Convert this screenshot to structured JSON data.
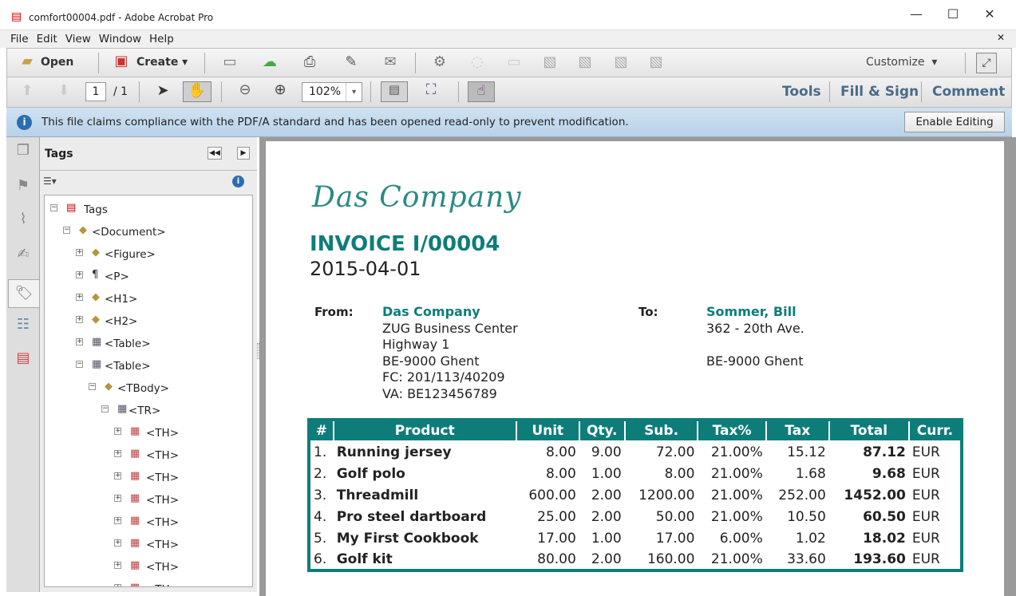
{
  "window": {
    "title": "comfort00004.pdf - Adobe Acrobat Pro",
    "minimize": "—",
    "maximize": "☐",
    "close": "✕",
    "doc_close": "✕"
  },
  "menu": [
    "File",
    "Edit",
    "View",
    "Window",
    "Help"
  ],
  "toolbar": {
    "open": "Open",
    "create": "Create",
    "customize": "Customize"
  },
  "nav": {
    "page": "1",
    "page_total": "/ 1",
    "zoom": "102%",
    "tools": "Tools",
    "fill_sign": "Fill & Sign",
    "comment": "Comment"
  },
  "infobar": {
    "message": "This file claims compliance with the PDF/A standard and has been opened read-only to prevent modification.",
    "enable": "Enable Editing"
  },
  "tags_panel": {
    "title": "Tags",
    "tree": [
      {
        "label": "Tags",
        "level": 0,
        "exp": "−",
        "icon": "pdf"
      },
      {
        "label": "<Document>",
        "level": 1,
        "exp": "−",
        "icon": "tag"
      },
      {
        "label": "<Figure>",
        "level": 2,
        "exp": "+",
        "icon": "tag"
      },
      {
        "label": "<P>",
        "level": 2,
        "exp": "+",
        "icon": "para"
      },
      {
        "label": "<H1>",
        "level": 2,
        "exp": "+",
        "icon": "tag"
      },
      {
        "label": "<H2>",
        "level": 2,
        "exp": "+",
        "icon": "tag"
      },
      {
        "label": "<Table>",
        "level": 2,
        "exp": "+",
        "icon": "table"
      },
      {
        "label": "<Table>",
        "level": 2,
        "exp": "−",
        "icon": "table"
      },
      {
        "label": "<TBody>",
        "level": 3,
        "exp": "−",
        "icon": "tag"
      },
      {
        "label": "<TR>",
        "level": 4,
        "exp": "−",
        "icon": "table"
      },
      {
        "label": "<TH>",
        "level": 5,
        "exp": "+",
        "icon": "cell"
      },
      {
        "label": "<TH>",
        "level": 5,
        "exp": "+",
        "icon": "cell"
      },
      {
        "label": "<TH>",
        "level": 5,
        "exp": "+",
        "icon": "cell"
      },
      {
        "label": "<TH>",
        "level": 5,
        "exp": "+",
        "icon": "cell"
      },
      {
        "label": "<TH>",
        "level": 5,
        "exp": "+",
        "icon": "cell"
      },
      {
        "label": "<TH>",
        "level": 5,
        "exp": "+",
        "icon": "cell"
      },
      {
        "label": "<TH>",
        "level": 5,
        "exp": "+",
        "icon": "cell"
      },
      {
        "label": "<TH>",
        "level": 5,
        "exp": "+",
        "icon": "cell"
      }
    ]
  },
  "invoice": {
    "logo": "Das Company",
    "title": "INVOICE I/00004",
    "date": "2015-04-01",
    "from_label": "From:",
    "from": [
      "Das Company",
      "ZUG Business Center",
      "Highway 1",
      "BE-9000 Ghent",
      "FC: 201/113/40209",
      "VA: BE123456789"
    ],
    "to_label": "To:",
    "to": [
      "Sommer, Bill",
      "362 - 20th Ave.",
      "",
      "BE-9000 Ghent"
    ],
    "headers": [
      "#",
      "Product",
      "Unit",
      "Qty.",
      "Sub.",
      "Tax%",
      "Tax",
      "Total",
      "Curr."
    ],
    "rows": [
      [
        "1.",
        "Running jersey",
        "8.00",
        "9.00",
        "72.00",
        "21.00%",
        "15.12",
        "87.12",
        "EUR"
      ],
      [
        "2.",
        "Golf polo",
        "8.00",
        "1.00",
        "8.00",
        "21.00%",
        "1.68",
        "9.68",
        "EUR"
      ],
      [
        "3.",
        "Threadmill",
        "600.00",
        "2.00",
        "1200.00",
        "21.00%",
        "252.00",
        "1452.00",
        "EUR"
      ],
      [
        "4.",
        "Pro steel dartboard",
        "25.00",
        "2.00",
        "50.00",
        "21.00%",
        "10.50",
        "60.50",
        "EUR"
      ],
      [
        "5.",
        "My First Cookbook",
        "17.00",
        "1.00",
        "17.00",
        "6.00%",
        "1.02",
        "18.02",
        "EUR"
      ],
      [
        "6.",
        "Golf kit",
        "80.00",
        "2.00",
        "160.00",
        "21.00%",
        "33.60",
        "193.60",
        "EUR"
      ]
    ]
  },
  "colors": {
    "accent": "#0e7d7a"
  }
}
